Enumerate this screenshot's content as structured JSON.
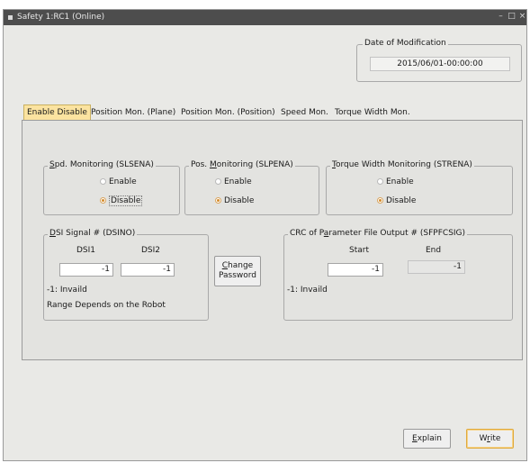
{
  "window": {
    "title": "Safety 1:RC1 (Online)",
    "minimize": "–",
    "maximize": "□",
    "close": "×"
  },
  "date_mod": {
    "legend": "Date of Modification",
    "value": "2015/06/01-00:00:00"
  },
  "tabs": [
    {
      "label": "Enable Disable",
      "active": true
    },
    {
      "label": "Position Mon. (Plane)"
    },
    {
      "label": "Position Mon. (Position)"
    },
    {
      "label": "Speed Mon."
    },
    {
      "label": "Torque Width Mon."
    }
  ],
  "spd": {
    "legend_prefix": "",
    "legend_u": "S",
    "legend_rest": "pd. Monitoring (SLSENA)",
    "enable": "Enable",
    "disable": "Disable",
    "selected": "Disable"
  },
  "pos": {
    "legend_prefix": "Pos. ",
    "legend_u": "M",
    "legend_rest": "onitoring (SLPENA)",
    "enable": "Enable",
    "disable": "Disable",
    "selected": "Disable"
  },
  "torque": {
    "legend_prefix": "",
    "legend_u": "T",
    "legend_rest": "orque Width Monitoring (STRENA)",
    "enable": "Enable",
    "disable": "Disable",
    "selected": "Disable"
  },
  "dsi": {
    "legend_prefix": "",
    "legend_u": "D",
    "legend_rest": "SI Signal # (DSINO)",
    "col1": "DSI1",
    "col2": "DSI2",
    "val1": "-1",
    "val2": "-1",
    "note1": "-1: Invaild",
    "note2": "Range Depends on the Robot"
  },
  "change_password": {
    "line1_u": "C",
    "line1_rest": "hange",
    "line2": "Password"
  },
  "crc": {
    "legend_prefix": "CRC of P",
    "legend_u": "a",
    "legend_rest": "rameter File Output # (SFPFCSIG)",
    "col_start": "Start",
    "col_end": "End",
    "start": "-1",
    "end": "-1",
    "note": "-1: Invaild"
  },
  "buttons": {
    "explain_u": "E",
    "explain_rest": "xplain",
    "write_pre": "W",
    "write_u": "r",
    "write_rest": "ite"
  }
}
